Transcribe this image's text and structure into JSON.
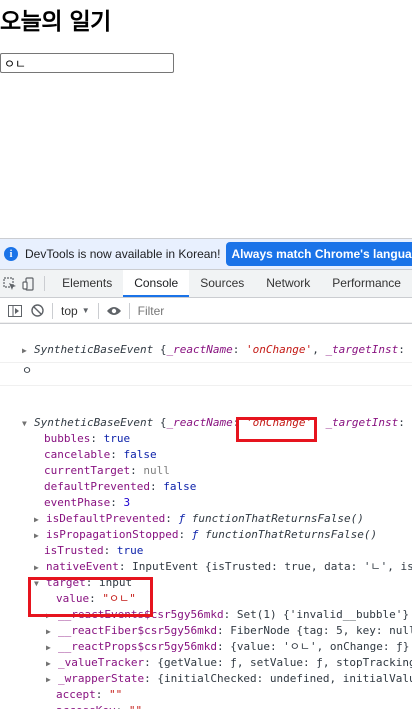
{
  "page": {
    "title": "오늘의 일기",
    "input_value": "ㅇㄴ"
  },
  "devtools": {
    "infobar": {
      "text": "DevTools is now available in Korean!",
      "button": "Always match Chrome's language"
    },
    "tabs": [
      "Elements",
      "Console",
      "Sources",
      "Network",
      "Performance"
    ],
    "active_tab": "Console",
    "filter": {
      "context": "top",
      "placeholder": "Filter"
    }
  },
  "console": {
    "row1": {
      "obj": "SyntheticBaseEvent",
      "open": " {",
      "k1": "_reactName",
      "v1": "'onChange'",
      "sep": ", ",
      "k2": "_targetInst",
      "k2colon": ": n"
    },
    "row2": {
      "text": "ㅇ"
    },
    "row3": {
      "obj": "SyntheticBaseEvent",
      "open": " {",
      "k1": "_reactName",
      "v1": "'onChange'",
      "sep": ", ",
      "k2": "_targetInst",
      "k2colon": ": n"
    },
    "props": [
      {
        "key": "bubbles",
        "value": "true"
      },
      {
        "key": "cancelable",
        "value": "false"
      },
      {
        "key": "currentTarget",
        "value": "null"
      },
      {
        "key": "defaultPrevented",
        "value": "false"
      },
      {
        "key": "eventPhase",
        "value": "3"
      }
    ],
    "isDefaultPrevented": {
      "key": "isDefaultPrevented",
      "f": "ƒ",
      "fname": "functionThatReturnsFalse()"
    },
    "isPropagationStopped": {
      "key": "isPropagationStopped",
      "f": "ƒ",
      "fname": "functionThatReturnsFalse()"
    },
    "isTrusted": {
      "key": "isTrusted",
      "value": "true"
    },
    "nativeEvent": {
      "key": "nativeEvent",
      "value": "InputEvent {isTrusted: true, data: 'ㄴ', is"
    },
    "target": {
      "key": "target",
      "value": "input"
    },
    "target_value": {
      "key": "value",
      "value": "\"ㅇㄴ\""
    },
    "react_rows": [
      {
        "key": "__reactEvents$csr5gy56mkd",
        "value": "Set(1) {'invalid__bubble'}"
      },
      {
        "key": "__reactFiber$csr5gy56mkd",
        "value": "FiberNode {tag: 5, key: null"
      },
      {
        "key": "__reactProps$csr5gy56mkd",
        "value": "{value: 'ㅇㄴ', onChange: ƒ}"
      },
      {
        "key": "_valueTracker",
        "value": "{getValue: ƒ, setValue: ƒ, stopTracking"
      },
      {
        "key": "_wrapperState",
        "value": "{initialChecked: undefined, initialValu"
      }
    ],
    "accept": {
      "key": "accept",
      "value": "\"\""
    },
    "accessKey": {
      "key": "accessKey",
      "value": "\"\""
    }
  },
  "colors": {
    "accent": "#1a73e8",
    "highlight": "#e6141e"
  }
}
